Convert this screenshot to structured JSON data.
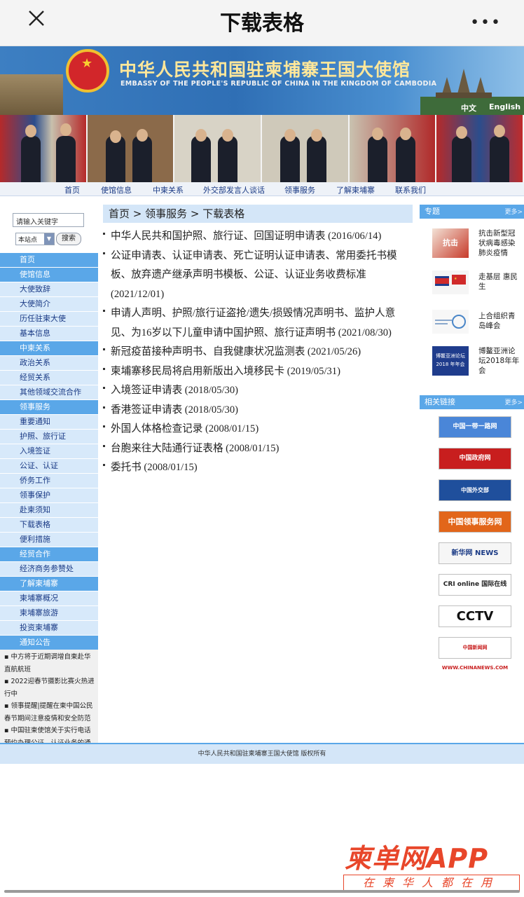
{
  "topbar": {
    "title": "下载表格",
    "more": "•••"
  },
  "banner": {
    "title_cn": "中华人民共和国驻柬埔寨王国大使馆",
    "title_en": "EMBASSY OF THE PEOPLE'S REPUBLIC OF CHINA IN THE KINGDOM OF CAMBODIA",
    "lang_cn": "中文",
    "lang_en": "English"
  },
  "nav": [
    "首页",
    "使馆信息",
    "中柬关系",
    "外交部发言人谈话",
    "领事服务",
    "了解柬埔寨",
    "联系我们"
  ],
  "search": {
    "placeholder": "请输入关键字",
    "scope": "本站点",
    "button": "搜索"
  },
  "sidebar": {
    "home": "首页",
    "sections": [
      {
        "title": "使馆信息",
        "items": [
          "大使致辞",
          "大使简介",
          "历任驻柬大使",
          "基本信息"
        ]
      },
      {
        "title": "中柬关系",
        "items": [
          "政治关系",
          "经贸关系",
          "其他领域交流合作"
        ]
      },
      {
        "title": "领事服务",
        "items": [
          "重要通知",
          "护照、旅行证",
          "入境签证",
          "公证、认证",
          "侨务工作",
          "领事保护",
          "赴柬须知",
          "下载表格",
          "便利措施"
        ]
      },
      {
        "title": "经贸合作",
        "items": [
          "经济商务参赞处"
        ]
      },
      {
        "title": "了解柬埔寨",
        "items": [
          "柬埔寨概况",
          "柬埔寨旅游",
          "投资柬埔寨"
        ]
      }
    ],
    "notices_title": "通知公告",
    "notices": [
      "中方将于近期调增自柬赴华直航航班",
      "2022迎春节摄影比赛火热进行中",
      "领事提醒|提醒在柬中国公民春节期间注意疫情和安全防范",
      "中国驻柬使馆关于实行电话预约办理公证、认证业务的通知"
    ]
  },
  "breadcrumb": "首页 > 领事服务 > 下载表格",
  "forms": [
    "中华人民共和国护照、旅行证、回国证明申请表 (2016/06/14)",
    "公证申请表、认证申请表、死亡证明认证申请表、常用委托书模板、放弃遗产继承声明书模板、公证、认证业务收费标准 (2021/12/01)",
    "申请人声明、护照/旅行证盗抢/遗失/损毁情况声明书、监护人意见、为16岁以下儿童申请中国护照、旅行证声明书 (2021/08/30)",
    "新冠疫苗接种声明书、自我健康状况监测表 (2021/05/26)",
    "柬埔寨移民局将启用新版出入境移民卡 (2019/05/31)",
    "入境签证申请表 (2018/05/30)",
    "香港签证申请表 (2018/05/30)",
    "外国人体格检查记录 (2008/01/15)",
    "台胞来往大陆通行证表格 (2008/01/15)",
    "委托书 (2008/01/15)"
  ],
  "right": {
    "topics_title": "专题",
    "more": "更多>",
    "topics": [
      "抗击新型冠状病毒感染肺炎疫情",
      "走基层 惠民生",
      "上合组织青岛峰会",
      "博鳌亚洲论坛2018年年会"
    ],
    "topic_images": [
      "抗击",
      "",
      "",
      "博鳌亚洲论坛 2018 年年会"
    ],
    "links_title": "相关链接",
    "links": [
      {
        "label": "中国一带一路网",
        "bg": "#4a86d8",
        "fg": "#ffffff"
      },
      {
        "label": "中国政府网 www.gov.cn",
        "bg": "#c81e1e",
        "fg": "#ffffff"
      },
      {
        "label": "中国外交部 www.fmprc.gov.cn",
        "bg": "#1f4f9c",
        "fg": "#ffffff"
      },
      {
        "label": "中国领事服务网",
        "bg": "#e2661a",
        "fg": "#ffffff"
      },
      {
        "label": "新华网 NEWS",
        "bg": "#f6f6f6",
        "fg": "#1a3a85"
      },
      {
        "label": "CRI online 国际在线",
        "bg": "#ffffff",
        "fg": "#222222"
      },
      {
        "label": "CCTV",
        "bg": "#ffffff",
        "fg": "#111111"
      },
      {
        "label": "中国新闻网 WWW.CHINANEWS.COM",
        "bg": "#ffffff",
        "fg": "#c81e1e"
      }
    ]
  },
  "footer": "中华人民共和国驻柬埔寨王国大使馆 版权所有",
  "app": {
    "logo": "柬单网APP",
    "slogan": "在柬华人都在用"
  },
  "colors": {
    "accent": "#5aa7e8",
    "light": "#d7e9fa",
    "link": "#1a3a85",
    "brand": "#e8462a"
  }
}
